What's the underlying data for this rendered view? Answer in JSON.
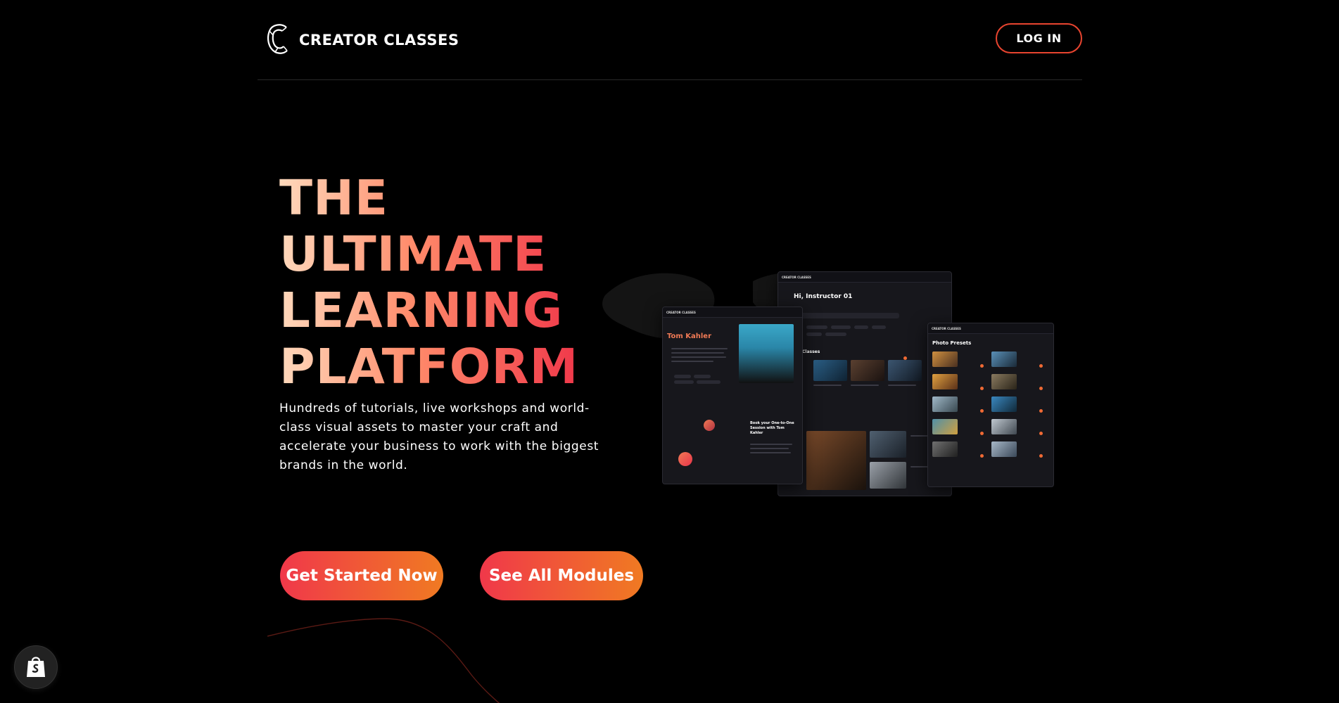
{
  "header": {
    "logo_text": "CREATOR CLASSES",
    "login_label": "LOG IN"
  },
  "hero": {
    "title_lines": [
      "THE",
      "ULTIMATE",
      "LEARNING",
      "PLATFORM"
    ],
    "subtitle": "Hundreds of tutorials, live workshops and world-class visual assets to master your craft and accelerate your business to work with the biggest brands in the world.",
    "cta_primary": "Get Started Now",
    "cta_secondary": "See All Modules"
  },
  "mockups": {
    "center_greeting": "Hi, Instructor 01",
    "center_section": "Classes",
    "left_name": "Tom Kahler",
    "left_booking": "Book your One-to-One Session with Tom Kahler",
    "right_title": "Photo Presets"
  },
  "colors": {
    "accent": "#f0384a",
    "accent_secondary": "#f07a22",
    "background": "#000000"
  },
  "icons": {
    "shopify_badge": "shopping-bag-icon",
    "logo": "logo-c-icon"
  }
}
